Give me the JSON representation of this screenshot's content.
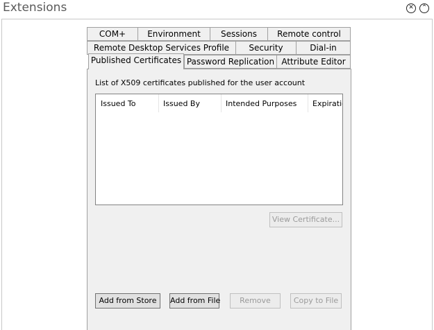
{
  "window": {
    "title": "Extensions"
  },
  "tabs": {
    "row1": [
      "COM+",
      "Environment",
      "Sessions",
      "Remote control"
    ],
    "row2": [
      "Remote Desktop Services Profile",
      "Security",
      "Dial-in"
    ],
    "row3": [
      "Published Certificates",
      "Password Replication",
      "Attribute Editor"
    ],
    "active": "Published Certificates"
  },
  "certs": {
    "description": "List of X509 certificates published for the user account",
    "columns": [
      "Issued To",
      "Issued By",
      "Intended Purposes",
      "Expiration"
    ],
    "rows": []
  },
  "buttons": {
    "view_certificate": "View Certificate...",
    "add_from_store": "Add from Store",
    "add_from_file": "Add from File",
    "remove": "Remove",
    "copy_to_file": "Copy to File"
  }
}
